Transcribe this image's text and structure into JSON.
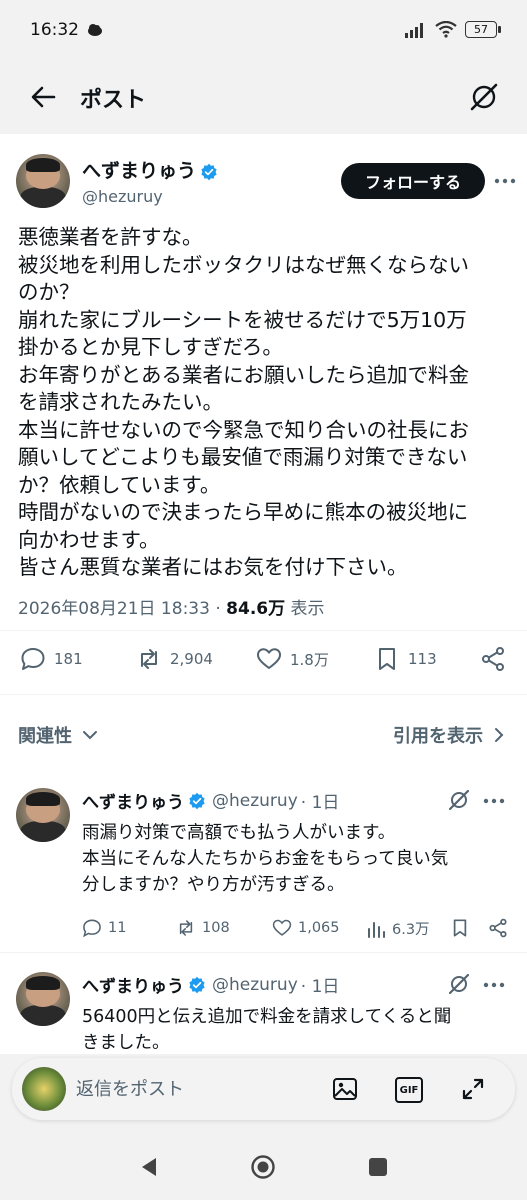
{
  "status_bar": {
    "time": "16:32",
    "battery": "57"
  },
  "header": {
    "title": "ポスト"
  },
  "tweet": {
    "author_name": "へずまりゅう",
    "handle": "@hezuruy",
    "follow_label": "フォローする",
    "lines": [
      "悪徳業者を許すな。",
      "被災地を利用したボッタクリはなぜ無くならない",
      "のか？",
      "崩れた家にブルーシートを被せるだけで5万10万",
      "掛かるとか見下しすぎだろ。",
      "お年寄りがとある業者にお願いしたら追加で料金",
      "を請求されたみたい。",
      "本当に許せないので今緊急で知り合いの社長にお",
      "願いしてどこよりも最安値で雨漏り対策できない",
      "か？依頼しています。",
      "時間がないので決まったら早めに熊本の被災地に",
      "向かわせます。",
      "皆さん悪質な業者にはお気を付け下さい。"
    ],
    "timestamp": "2026年08月21日 18:33",
    "separator": "·",
    "views": "84.6万",
    "views_suffix": "表示",
    "stats": {
      "replies": "181",
      "reposts": "2,904",
      "likes": "1.8万",
      "bookmarks": "113"
    }
  },
  "sort": {
    "left_label": "関連性",
    "right_label": "引用を表示"
  },
  "replies": [
    {
      "name": "へずまりゅう",
      "handle": "@hezuruy",
      "time": "· 1日",
      "lines": [
        "雨漏り対策で高額でも払う人がいます。",
        "本当にそんな人たちからお金をもらって良い気",
        "分しますか？やり方が汚すぎる。"
      ],
      "stats": {
        "replies": "11",
        "reposts": "108",
        "likes": "1,065",
        "views": "6.3万"
      }
    },
    {
      "name": "へずまりゅう",
      "handle": "@hezuruy",
      "time": "· 1日",
      "lines": [
        "56400円と伝え追加で料金を請求してくると聞",
        "きました。"
      ]
    }
  ],
  "composer": {
    "placeholder": "返信をポスト",
    "gif_label": "GIF"
  },
  "colors": {
    "verified": "#1d9bf0",
    "text": "#0f1419",
    "secondary": "#536471",
    "follow_bg": "#0f1419"
  }
}
